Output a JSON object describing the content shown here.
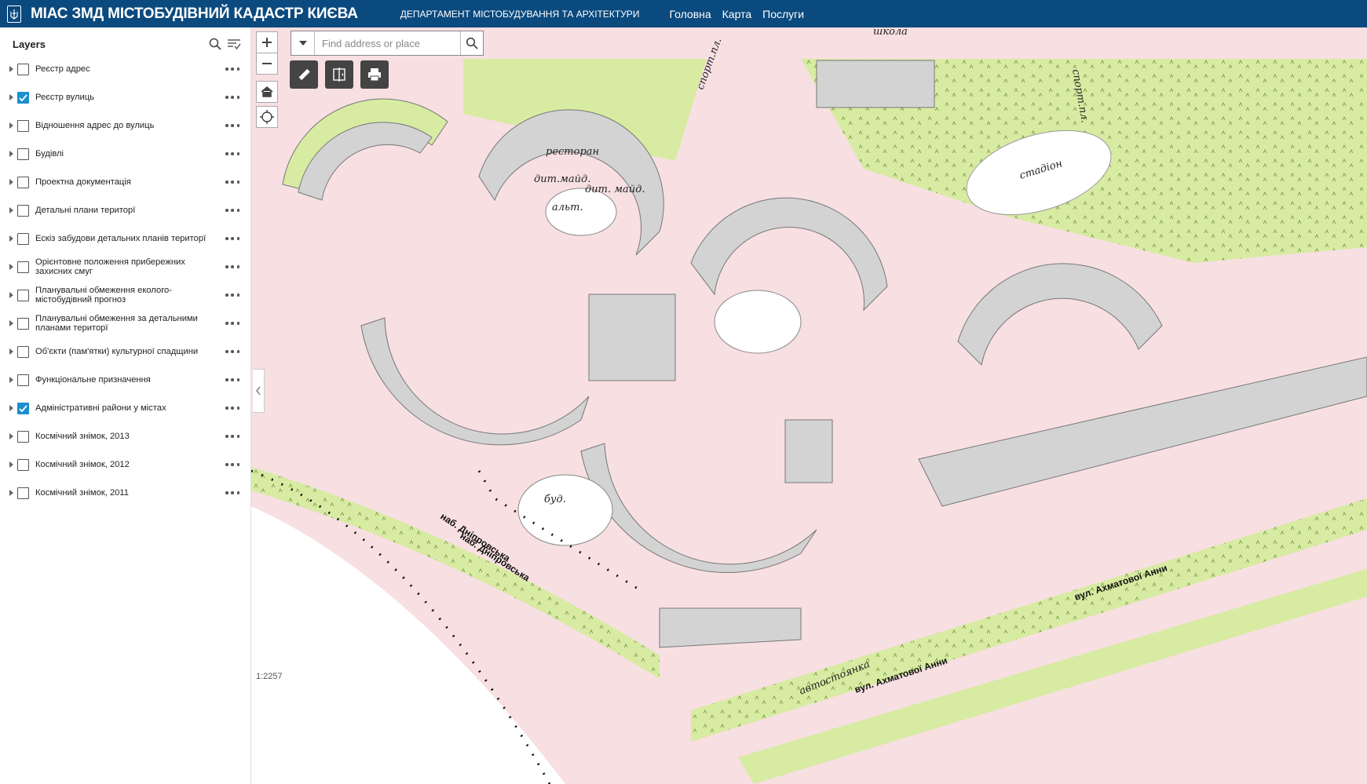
{
  "header": {
    "title": "МІАС ЗМД МІСТОБУДІВНИЙ КАДАСТР КИЄВА",
    "department": "ДЕПАРТАМЕНТ МІСТОБУДУВАННЯ ТА АРХІТЕКТУРИ",
    "nav": [
      "Головна",
      "Карта",
      "Послуги"
    ]
  },
  "panel": {
    "title": "Layers",
    "layers": [
      {
        "label": "Реєстр адрес",
        "checked": false
      },
      {
        "label": "Реєстр вулиць",
        "checked": true
      },
      {
        "label": "Відношення адрес до вулиць",
        "checked": false
      },
      {
        "label": "Будівлі",
        "checked": false
      },
      {
        "label": "Проектна документація",
        "checked": false
      },
      {
        "label": "Детальні плани територї",
        "checked": false
      },
      {
        "label": "Ескіз забудови детальних планів територї",
        "checked": false
      },
      {
        "label": "Орієнтовне положення прибережних захисних смуг",
        "checked": false
      },
      {
        "label": "Планувальні обмеження еколого-містобудівний прогноз",
        "checked": false
      },
      {
        "label": "Планувальні обмеження за детальними планами територї",
        "checked": false
      },
      {
        "label": "Об'єкти (пам'ятки) культурної спадщини",
        "checked": false
      },
      {
        "label": "Функціональне призначення",
        "checked": false
      },
      {
        "label": "Адміністративні райони у містах",
        "checked": true
      },
      {
        "label": "Космічний знімок, 2013",
        "checked": false
      },
      {
        "label": "Космічний знімок, 2012",
        "checked": false
      },
      {
        "label": "Космічний знімок, 2011",
        "checked": false
      }
    ]
  },
  "search": {
    "placeholder": "Find address or place"
  },
  "map": {
    "scale": "1:2257",
    "labels": {
      "school": "школа",
      "sport1": "спорт.пл.",
      "sport2": "спорт.пл.",
      "stadium": "стадіон",
      "restaurant": "ресторан",
      "playground1": "дит.майд.",
      "playground2": "дит. майд.",
      "alt": "альт.",
      "embankment1": "наб. Дніпровська",
      "embankment2": "наб. Дніпровська",
      "street1": "вул. Ахматової Анни",
      "street2": "вул. Ахматової Анни",
      "parking": "автостоянка",
      "construction": "буд."
    }
  },
  "colors": {
    "header_bg": "#0b4a7e",
    "checkbox_on": "#1a8fd1",
    "map_bg": "#f7dfe2",
    "green": "#d8eba2",
    "building": "#d3d3d3"
  }
}
